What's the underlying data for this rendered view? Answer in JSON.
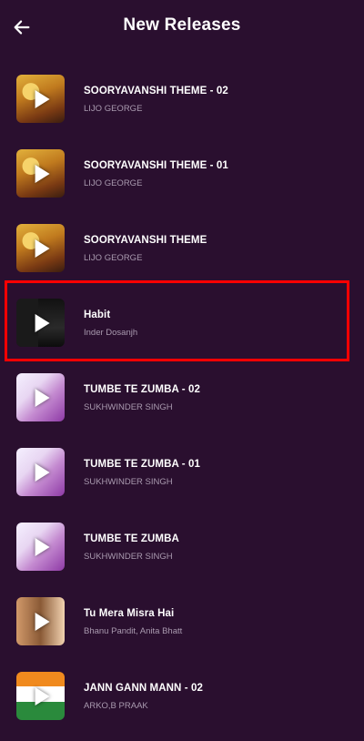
{
  "header": {
    "title": "New Releases",
    "back_icon": "arrow-left-icon"
  },
  "colors": {
    "background": "#2a0f2f",
    "title": "#ffffff",
    "subtitle": "#a99aaf",
    "highlight": "#ff0000"
  },
  "songs": [
    {
      "title": "SOORYAVANSHI THEME - 02",
      "artist": "LIJO GEORGE",
      "art": "soory"
    },
    {
      "title": "SOORYAVANSHI THEME - 01",
      "artist": "LIJO GEORGE",
      "art": "soory"
    },
    {
      "title": "SOORYAVANSHI THEME",
      "artist": "LIJO GEORGE",
      "art": "soory"
    },
    {
      "title": "Habit",
      "artist": "Inder Dosanjh",
      "art": "habit",
      "highlighted": true
    },
    {
      "title": "TUMBE TE ZUMBA - 02",
      "artist": "SUKHWINDER SINGH",
      "art": "tumbe"
    },
    {
      "title": "TUMBE TE ZUMBA - 01",
      "artist": "SUKHWINDER SINGH",
      "art": "tumbe"
    },
    {
      "title": "TUMBE TE ZUMBA",
      "artist": "SUKHWINDER SINGH",
      "art": "tumbe"
    },
    {
      "title": "Tu Mera Misra Hai",
      "artist": "Bhanu Pandit, Anita Bhatt",
      "art": "misra"
    },
    {
      "title": "JANN GANN MANN - 02",
      "artist": "ARKO,B PRAAK",
      "art": "jann"
    }
  ],
  "icons": {
    "play": "play-icon"
  }
}
